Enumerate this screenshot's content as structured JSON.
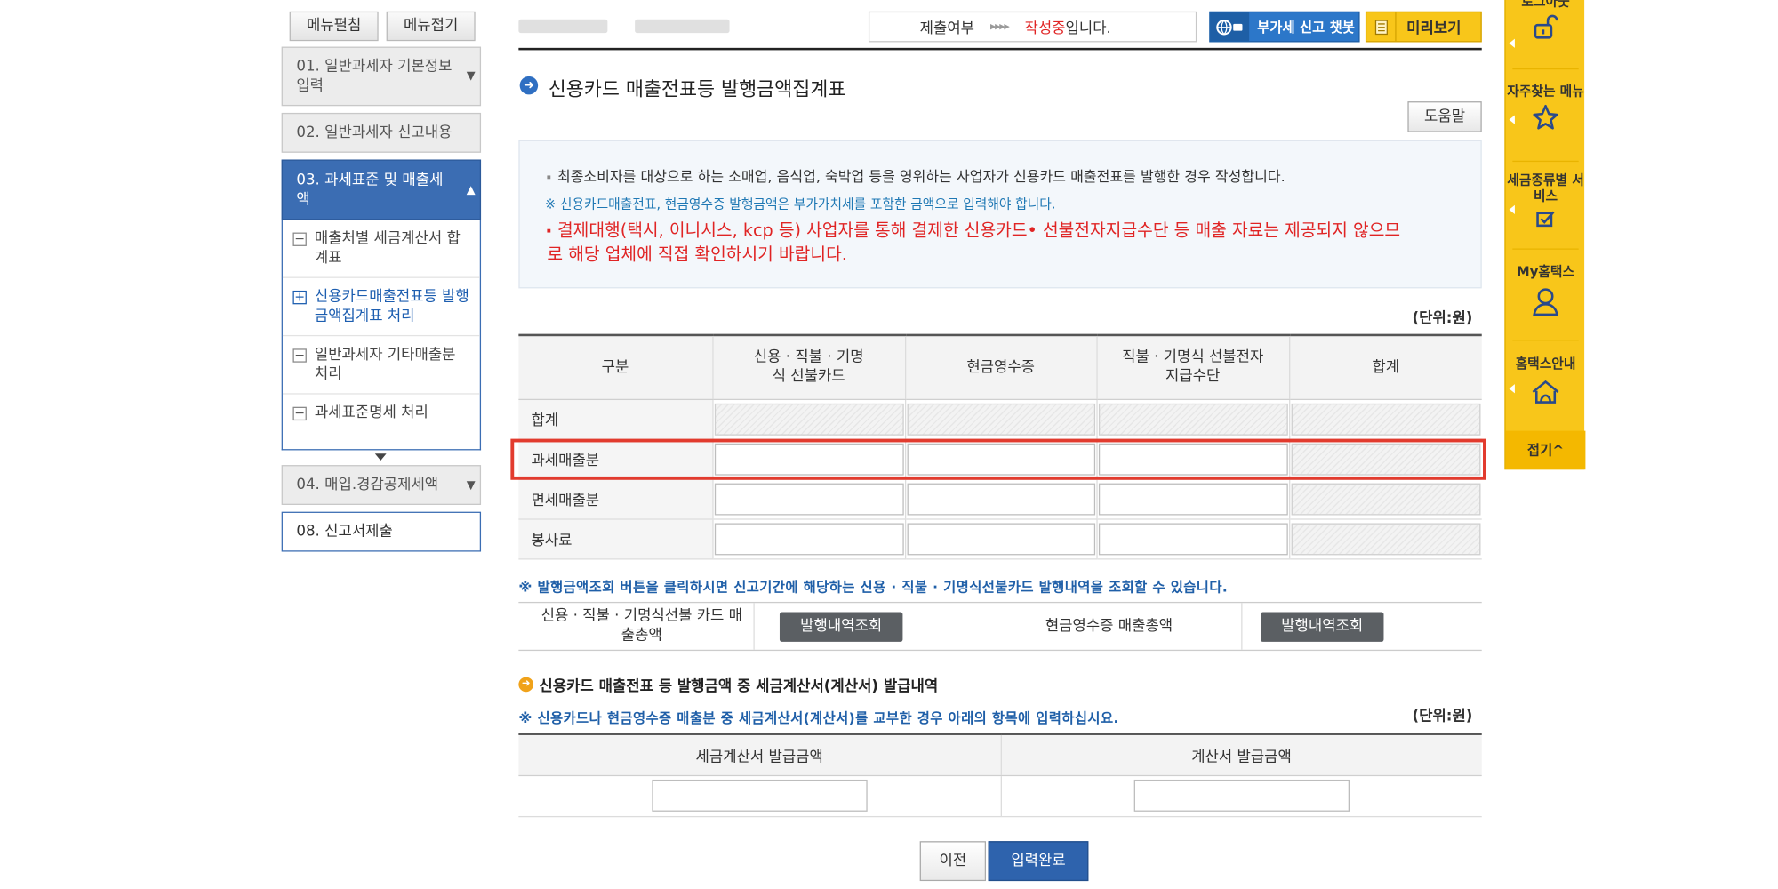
{
  "left_menu": {
    "expand_label": "메뉴펼침",
    "collapse_label": "메뉴접기",
    "items": [
      {
        "label": "01. 일반과세자 기본정보 입력"
      },
      {
        "label": "02. 일반과세자 신고내용"
      },
      {
        "label": "03. 과세표준 및 매출세액"
      },
      {
        "label": "04. 매입.경감공제세액"
      },
      {
        "label": "08. 신고서제출"
      }
    ],
    "sub_items": [
      {
        "label": "매출처별 세금계산서 합계표",
        "expander": "−"
      },
      {
        "label": "신용카드매출전표등 발행금액집계표 처리",
        "expander": "+"
      },
      {
        "label": "일반과세자 기타매출분 처리",
        "expander": "−"
      },
      {
        "label": "과세표준명세 처리",
        "expander": "−"
      }
    ]
  },
  "top_bar": {
    "status_label": "제출여부",
    "status_arrows": "▸▸▸▸",
    "status_value_red": "작성중",
    "status_value_suffix": "입니다.",
    "chatbot_label": "부가세 신고 챗봇",
    "preview_label": "미리보기"
  },
  "page": {
    "title": "신용카드 매출전표등 발행금액집계표",
    "help_label": "도움말"
  },
  "notice": {
    "line1": "최종소비자를 대상으로 하는 소매업, 음식업, 숙박업 등을 영위하는 사업자가 신용카드 매출전표를 발행한 경우 작성합니다.",
    "line2": "※ 신용카드매출전표, 현금영수증 발행금액은 부가가치세를 포함한 금액으로 입력해야 합니다.",
    "line3": "결제대행(택시, 이니시스, kcp 등) 사업자를 통해 결제한 신용카드• 선불전자지급수단 등 매출 자료는 제공되지 않으므로 해당 업체에 직접 확인하시기 바랍니다."
  },
  "unit_label": "(단위:원)",
  "main_table": {
    "headers": [
      "구분",
      "신용 · 직불 · 기명식 선불카드",
      "현금영수증",
      "직불 · 기명식 선불전자지급수단",
      "합계"
    ],
    "rows": [
      {
        "label": "합계"
      },
      {
        "label": "과세매출분"
      },
      {
        "label": "면세매출분"
      },
      {
        "label": "봉사료"
      }
    ]
  },
  "lookup": {
    "note": "※ 발행금액조회 버튼을 클릭하시면 신고기간에 해당하는 신용 · 직불 · 기명식선불카드 발행내역을 조회할 수 있습니다.",
    "card_label": "신용 · 직불 · 기명식선불 카드 매출총액",
    "card_button": "발행내역조회",
    "cash_label": "현금영수증 매출총액",
    "cash_button": "발행내역조회"
  },
  "invoice_section": {
    "title": "신용카드 매출전표 등 발행금액 중 세금계산서(계산서) 발급내역",
    "note": "※ 신용카드나 현금영수증 매출분 중 세금계산서(계산서)를 교부한 경우 아래의 항목에 입력하십시요.",
    "unit": "(단위:원)",
    "col1": "세금계산서 발급금액",
    "col2": "계산서 발급금액"
  },
  "footer": {
    "prev_label": "이전",
    "done_label": "입력완료"
  },
  "quick_menu": {
    "logout": "로그아웃",
    "favorites": "자주찾는 메뉴",
    "tax_service": "세금종류별 서비스",
    "my_hometax": "My홈택스",
    "guide": "홈택스안내",
    "fold": "접기^"
  },
  "colors": {
    "brand_blue": "#3b6db3",
    "alert_red": "#e02424",
    "quick_yellow": "#f8c61a",
    "highlight_box": "#e23b2e"
  }
}
